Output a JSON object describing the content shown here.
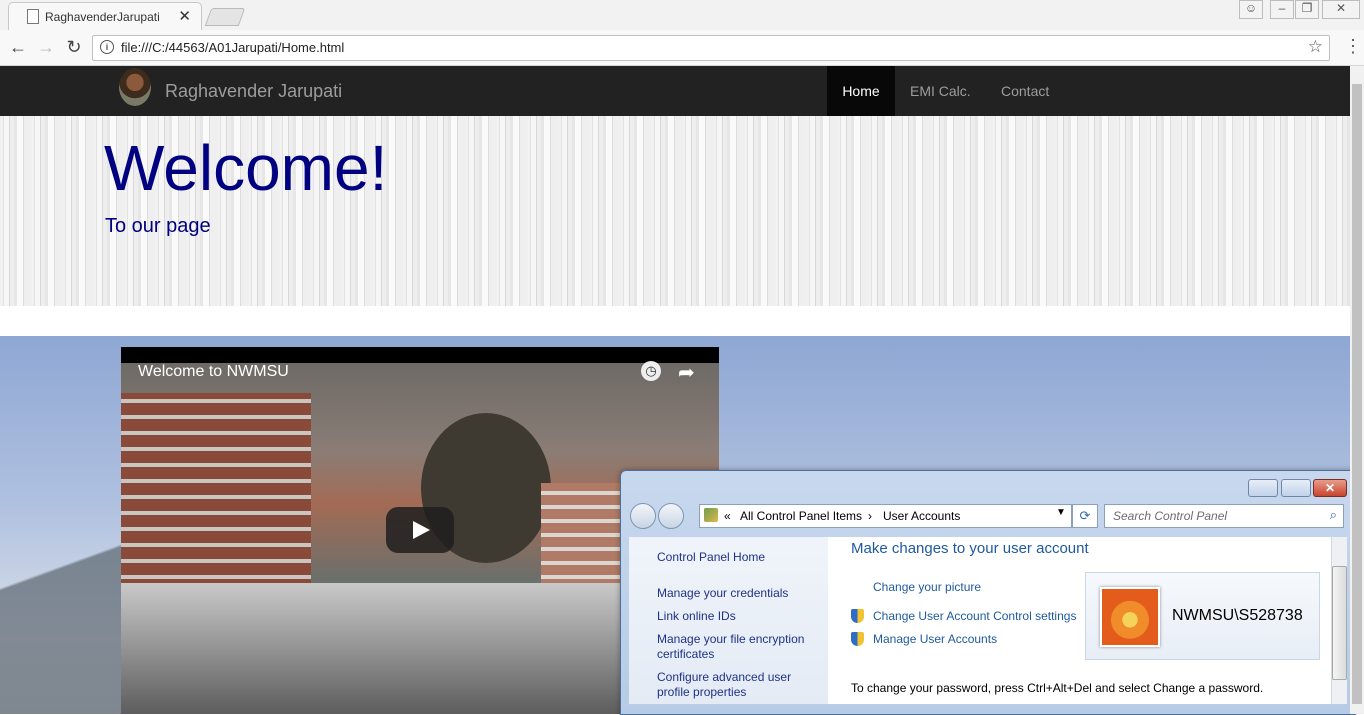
{
  "browser": {
    "tab_title": "RaghavenderJarupati",
    "url": "file:///C:/44563/A01Jarupati/Home.html",
    "icons": [
      "document-icon",
      "close-icon",
      "back-icon",
      "forward-icon",
      "reload-icon",
      "info-icon",
      "star-icon",
      "menu-icon",
      "account-icon",
      "minimize-icon",
      "restore-icon",
      "close-window-icon"
    ]
  },
  "site": {
    "brand": "Raghavender Jarupati",
    "nav": [
      "Home",
      "EMI Calc.",
      "Contact"
    ],
    "active_nav": "Home",
    "hero_title": "Welcome!",
    "hero_subtitle": "To our page",
    "colors": {
      "navbar": "#222222",
      "hero_text": "#000080"
    }
  },
  "video": {
    "title": "Welcome to NWMSU"
  },
  "control_panel": {
    "breadcrumb": [
      "«",
      "All Control Panel Items",
      "›",
      "User Accounts"
    ],
    "search_placeholder": "Search Control Panel",
    "left_links": [
      "Control Panel Home",
      "Manage your credentials",
      "Link online IDs",
      "Manage your file encryption certificates",
      "Configure advanced user profile properties"
    ],
    "heading": "Make changes to your user account",
    "links": [
      "Change your picture",
      "Change User Account Control settings",
      "Manage User Accounts"
    ],
    "username": "NWMSU\\S528738",
    "note": "To change your password, press Ctrl+Alt+Del and select Change a password."
  }
}
